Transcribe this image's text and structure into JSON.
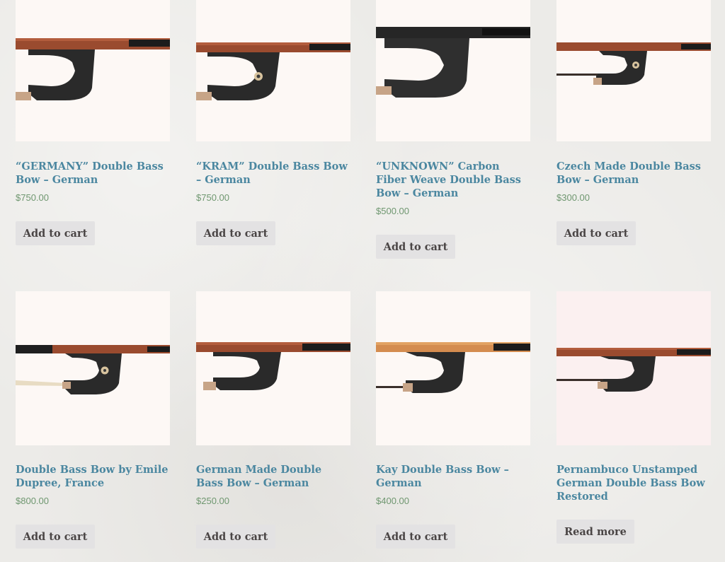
{
  "products": [
    {
      "title": "“GERMANY” Double Bass Bow – German",
      "price": "$750.00",
      "button": "Add to cart",
      "variant": "plain-frog"
    },
    {
      "title": "“KRAM” Double Bass Bow – German",
      "price": "$750.00",
      "button": "Add to cart",
      "variant": "eye-frog"
    },
    {
      "title": "“UNKNOWN” Carbon Fiber Weave Double Bass Bow – German",
      "price": "$500.00",
      "button": "Add to cart",
      "variant": "carbon-frog"
    },
    {
      "title": "Czech Made Double Bass Bow – German",
      "price": "$300.00",
      "button": "Add to cart",
      "variant": "eye-frog"
    },
    {
      "title": "Double Bass Bow by Emile Dupree, France",
      "price": "$800.00",
      "button": "Add to cart",
      "variant": "eye-frog"
    },
    {
      "title": "German Made Double Bass Bow – German",
      "price": "$250.00",
      "button": "Add to cart",
      "variant": "plain-frog"
    },
    {
      "title": "Kay Double Bass Bow – German",
      "price": "$400.00",
      "button": "Add to cart",
      "variant": "orange-frog"
    },
    {
      "title": "Pernambuco Unstamped German Double Bass Bow Restored",
      "price": "",
      "button": "Read more",
      "variant": "plain-frog"
    }
  ],
  "colors": {
    "title": "#4b87a0",
    "price": "#6f9770",
    "button_bg": "#e3e2e3",
    "button_text": "#4a4545",
    "thumb_bg": "#fdf8f5"
  }
}
